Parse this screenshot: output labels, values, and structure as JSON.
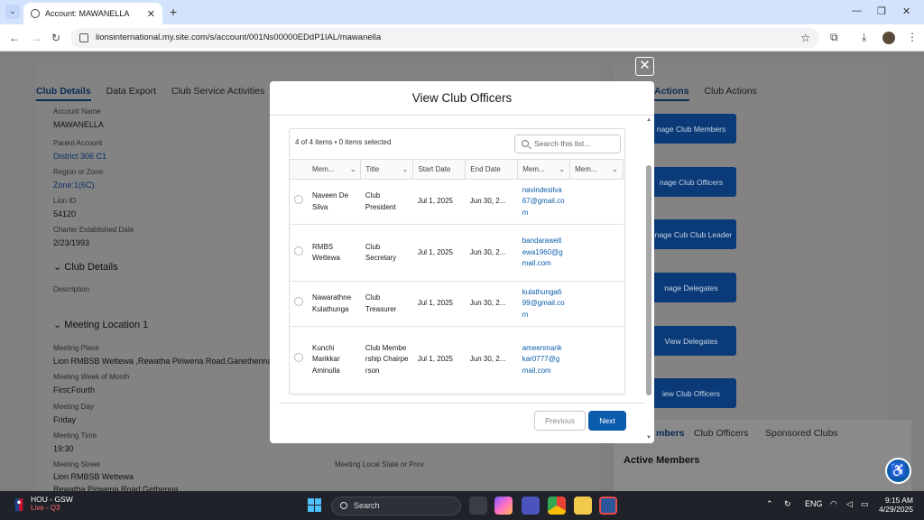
{
  "browser": {
    "tab_title": "Account: MAWANELLA",
    "url": "lionsinternational.my.site.com/s/account/001Ns00000EDdP1IAL/mawanella",
    "new_tab": "+",
    "tab_close": "✕"
  },
  "page": {
    "tabs": [
      "Club Details",
      "Data Export",
      "Club Service Activities"
    ],
    "fields": {
      "account_name_label": "Account Name",
      "account_name": "MAWANELLA",
      "parent_account_label": "Parent Account",
      "parent_account": "District 306 C1",
      "region_label": "Region or Zone",
      "region": "Zone:1(6C)",
      "lion_id_label": "Lion ID",
      "lion_id": "54120",
      "charter_label": "Charter Established Date",
      "charter": "2/23/1993",
      "club_details_section": "Club Details",
      "description_label": "Description",
      "meeting_location_section": "Meeting Location 1",
      "meeting_place_label": "Meeting Place",
      "meeting_place": "Lion RMBSB Wettewa ,Rewatha Piriwena Road,Ganethenna,",
      "meeting_week_label": "Meeting Week of Month",
      "meeting_week": "First;Fourth",
      "meeting_day_label": "Meeting Day",
      "meeting_day": "Friday",
      "meeting_time_label": "Meeting Time",
      "meeting_time": "19:30",
      "meeting_street_label": "Meeting Street",
      "meeting_street_1": "Lion RMBSB Wettewa",
      "meeting_street_2": "Rewatha Piriwena Road,Gethenna",
      "meeting_state_label": "Meeting Local State or Prov"
    },
    "right_tabs": [
      "Actions",
      "Club Actions"
    ],
    "right_buttons": [
      "nage Club Members",
      "nage Club Officers",
      "anage Cub Club Leader",
      "nage Delegates",
      "View Delegates",
      "iew Club Officers"
    ],
    "bottom_tabs": [
      "mbers",
      "Club Officers",
      "Sponsored Clubs"
    ],
    "active_members_title": "Active Members"
  },
  "modal": {
    "title": "View Club Officers",
    "count_text": "4 of 4 items • 0 items selected",
    "search_placeholder": "Search this list...",
    "columns": [
      "Mem...",
      "Title",
      "Start Date",
      "End Date",
      "Mem...",
      "Mem..."
    ],
    "rows": [
      {
        "name": "Naveen De Silva",
        "title": "Club President",
        "start": "Jul 1, 2025",
        "end": "Jun 30, 2...",
        "email": "navindesilva67@gmail.com"
      },
      {
        "name": "RMBS Wettewa",
        "title": "Club Secretary",
        "start": "Jul 1, 2025",
        "end": "Jun 30, 2...",
        "email": "bandaraweltewa1960@gmail.com"
      },
      {
        "name": "Nawarathne Kulathunga",
        "title": "Club Treasurer",
        "start": "Jul 1, 2025",
        "end": "Jun 30, 2...",
        "email": "kulathunga699@gmail.com"
      },
      {
        "name": "Kunchi Marikkar Aminulla",
        "title": "Club Membership Chairperson",
        "start": "Jul 1, 2025",
        "end": "Jun 30, 2...",
        "email": "ameenmarikkar0777@gmail.com"
      }
    ],
    "previous_label": "Previous",
    "next_label": "Next",
    "close": "✕"
  },
  "taskbar": {
    "weather_line1": "HOU - GSW",
    "weather_line2": "Live - Q3",
    "search_label": "Search",
    "lang": "ENG",
    "time": "9:15 AM",
    "date": "4/29/2025"
  },
  "colors": {
    "brand": "#0b5cad",
    "header_tab_bg": "#d3e3fd",
    "taskbar_bg": "#1f2228"
  }
}
